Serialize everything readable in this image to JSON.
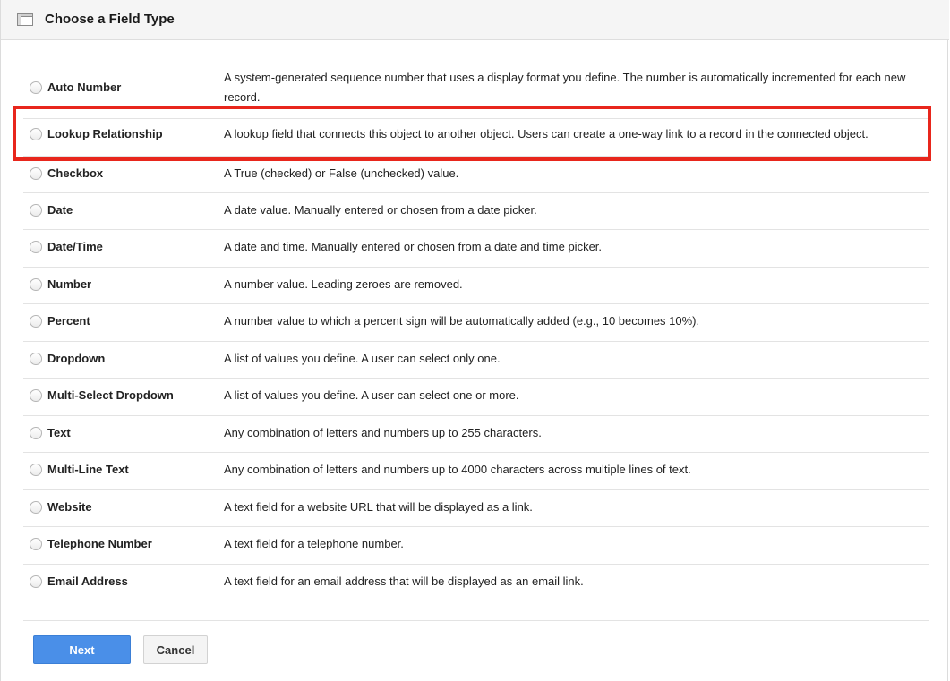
{
  "header": {
    "title": "Choose a Field Type",
    "icon": "window-icon"
  },
  "field_types": [
    {
      "label": "Auto Number",
      "description": "A system-generated sequence number that uses a display format you define. The number is automatically incremented for each new record.",
      "selected": false
    },
    {
      "label": "Lookup Relationship",
      "description": "A lookup field that connects this object to another object. Users can create a one-way link to a record in the connected object.",
      "selected": false,
      "highlighted": true
    },
    {
      "label": "Checkbox",
      "description": "A True (checked) or False (unchecked) value.",
      "selected": false
    },
    {
      "label": "Date",
      "description": "A date value. Manually entered or chosen from a date picker.",
      "selected": false
    },
    {
      "label": "Date/Time",
      "description": "A date and time. Manually entered or chosen from a date and time picker.",
      "selected": false
    },
    {
      "label": "Number",
      "description": "A number value. Leading zeroes are removed.",
      "selected": false
    },
    {
      "label": "Percent",
      "description": "A number value to which a percent sign will be automatically added (e.g., 10 becomes 10%).",
      "selected": false
    },
    {
      "label": "Dropdown",
      "description": "A list of values you define. A user can select only one.",
      "selected": false
    },
    {
      "label": "Multi-Select Dropdown",
      "description": "A list of values you define. A user can select one or more.",
      "selected": false
    },
    {
      "label": "Text",
      "description": "Any combination of letters and numbers up to 255 characters.",
      "selected": false
    },
    {
      "label": "Multi-Line Text",
      "description": "Any combination of letters and numbers up to 4000 characters across multiple lines of text.",
      "selected": false
    },
    {
      "label": "Website",
      "description": "A text field for a website URL that will be displayed as a link.",
      "selected": false
    },
    {
      "label": "Telephone Number",
      "description": "A text field for a telephone number.",
      "selected": false
    },
    {
      "label": "Email Address",
      "description": "A text field for an email address that will be displayed as an email link.",
      "selected": false
    }
  ],
  "actions": {
    "next_label": "Next",
    "cancel_label": "Cancel"
  },
  "colors": {
    "highlight": "#e8261c",
    "primary_button": "#4a8fe8"
  }
}
